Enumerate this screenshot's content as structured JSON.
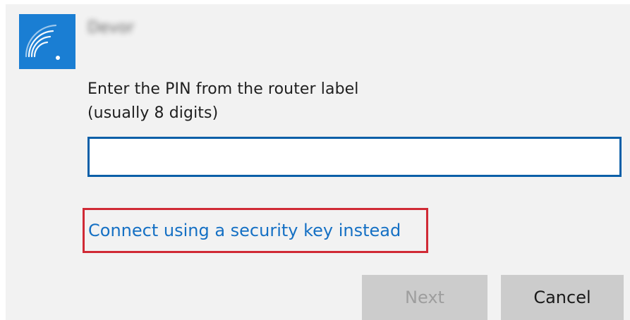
{
  "network": {
    "icon": "wifi-secure-icon",
    "name": "Devor"
  },
  "prompt": {
    "line1": "Enter the PIN from the router label",
    "line2": "(usually 8 digits)"
  },
  "pin_field": {
    "value": "",
    "placeholder": ""
  },
  "link": {
    "label": "Connect using a security key instead"
  },
  "buttons": {
    "next_label": "Next",
    "cancel_label": "Cancel"
  },
  "colors": {
    "accent": "#1a7ed3",
    "link": "#1570c4",
    "highlight_border": "#d02a35",
    "input_border": "#0b5fa8"
  }
}
